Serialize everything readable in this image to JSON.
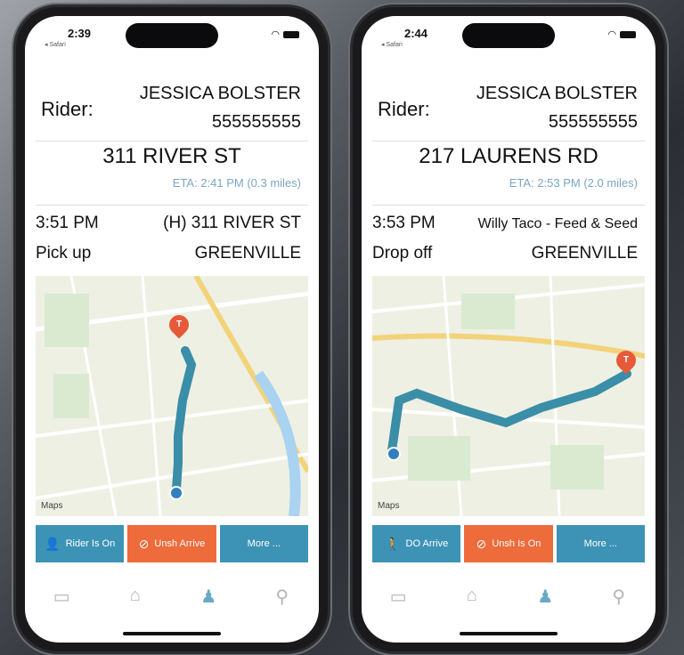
{
  "phones": [
    {
      "status": {
        "time": "2:39",
        "back": "◂ Safari"
      },
      "rider": {
        "label": "Rider:",
        "name": "JESSICA BOLSTER",
        "phone": "555555555"
      },
      "trip": {
        "address": "311 RIVER ST",
        "eta": "ETA: 2:41 PM (0.3 miles)",
        "time": "3:51 PM",
        "destination": "(H) 311 RIVER ST",
        "action": "Pick up",
        "city": "GREENVILLE"
      },
      "map": {
        "attribution": "Maps"
      },
      "buttons": [
        {
          "label": "Rider Is On",
          "color": "#3d93b5",
          "icon": "rider-icon"
        },
        {
          "label": "Unsh Arrive",
          "color": "#ee6b3b",
          "icon": "cancel-icon"
        },
        {
          "label": "More ...",
          "color": "#3d93b5",
          "icon": ""
        }
      ]
    },
    {
      "status": {
        "time": "2:44",
        "back": "◂ Safari"
      },
      "rider": {
        "label": "Rider:",
        "name": "JESSICA BOLSTER",
        "phone": "555555555"
      },
      "trip": {
        "address": "217 LAURENS RD",
        "eta": "ETA: 2:53 PM (2.0 miles)",
        "time": "3:53 PM",
        "destination": "Willy Taco - Feed & Seed",
        "action": "Drop off",
        "city": "GREENVILLE"
      },
      "map": {
        "attribution": "Maps"
      },
      "buttons": [
        {
          "label": "DO Arrive",
          "color": "#3d93b5",
          "icon": "walk-icon"
        },
        {
          "label": "Unsh Is On",
          "color": "#ee6b3b",
          "icon": "cancel-icon"
        },
        {
          "label": "More ...",
          "color": "#3d93b5",
          "icon": ""
        }
      ]
    }
  ]
}
